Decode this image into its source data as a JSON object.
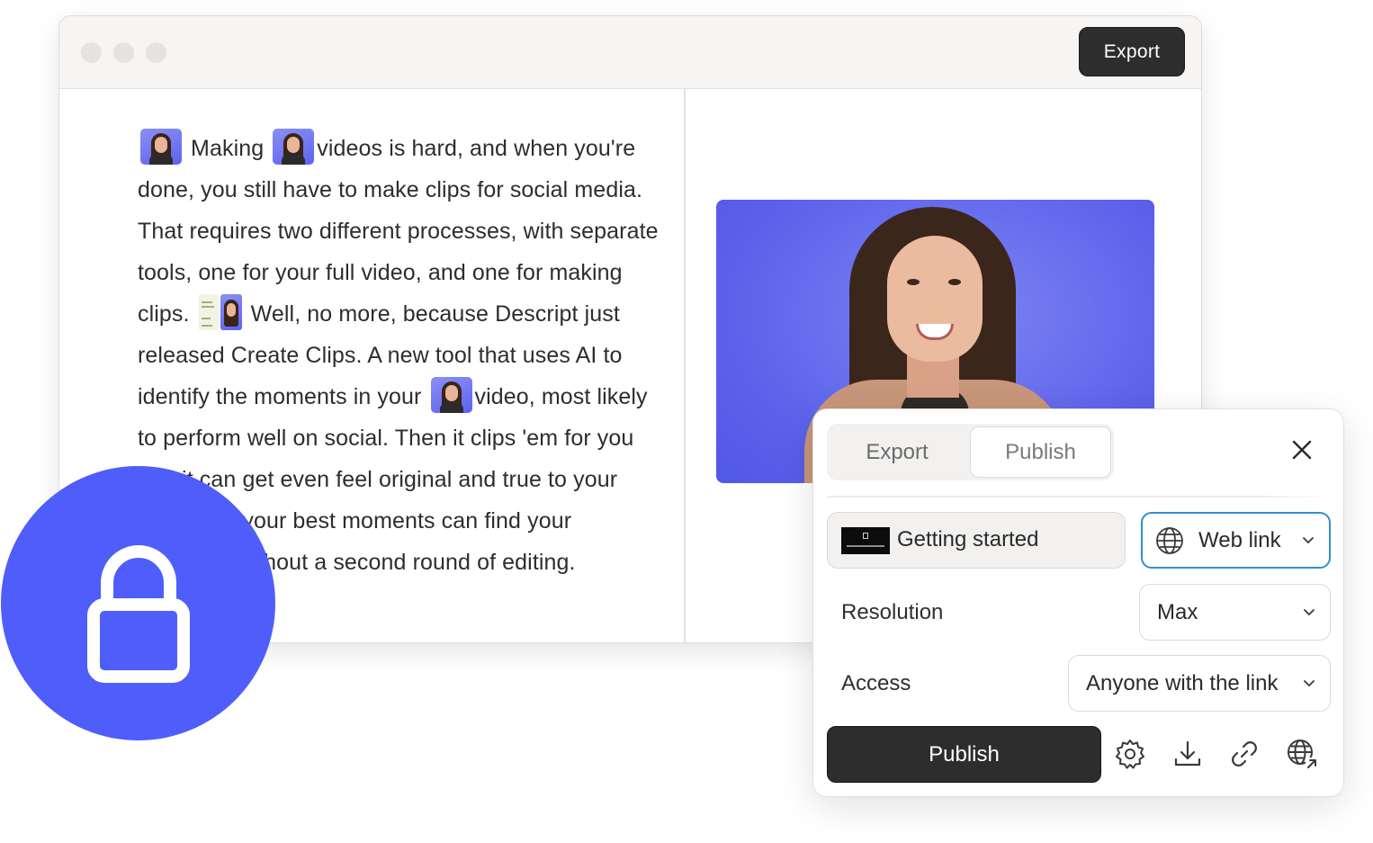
{
  "window": {
    "export_label": "Export"
  },
  "transcript": {
    "segments": {
      "s1": "Making",
      "s2": "videos is hard, and when you're done, you still have to make clips for social media. That requires two different processes, with separate tools, one for your full video, and one for making clips.",
      "s3": "Well, no more, because Descript just released Create Clips. A new tool that uses AI to identify the moments in your",
      "s4": "video, most likely to perform well on social. Then it clips 'em for you and it can get even feel original and true to your brand. So your best moments can find your audience without a second round of editing."
    }
  },
  "publish_panel": {
    "tabs": {
      "export": "Export",
      "publish": "Publish"
    },
    "active_tab": "Publish",
    "project_name": "Getting started",
    "destination": "Web link",
    "resolution": {
      "label": "Resolution",
      "value": "Max"
    },
    "access": {
      "label": "Access",
      "value": "Anyone with the link"
    },
    "publish_button": "Publish",
    "tools": [
      "gear-icon",
      "download-icon",
      "link-icon",
      "globe-share-icon"
    ],
    "accent": "#2f8fcf"
  },
  "colors": {
    "lock_badge": "#4f5dfb",
    "video_background": "#5a60ea",
    "primary_button": "#2d2d2d"
  }
}
